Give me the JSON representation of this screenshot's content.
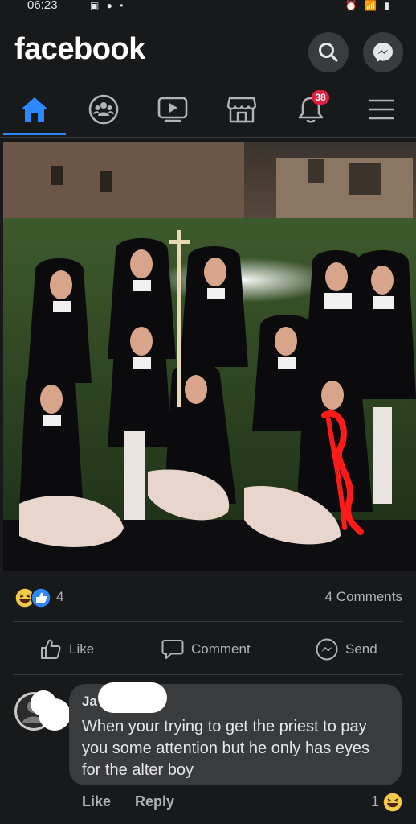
{
  "status_bar": {
    "time": "06:23",
    "left_icons": "▣ ● •",
    "right_icons": "⏰ 📶 ▮"
  },
  "header": {
    "brand": "facebook",
    "search_icon": "search-icon",
    "messenger_icon": "messenger-icon"
  },
  "tabs": [
    {
      "name": "home",
      "icon": "home-icon",
      "active": true
    },
    {
      "name": "groups",
      "icon": "groups-icon",
      "active": false
    },
    {
      "name": "watch",
      "icon": "watch-icon",
      "active": false
    },
    {
      "name": "marketplace",
      "icon": "marketplace-icon",
      "active": false
    },
    {
      "name": "notifications",
      "icon": "bell-icon",
      "badge": "38",
      "active": false
    },
    {
      "name": "menu",
      "icon": "menu-icon",
      "active": false
    }
  ],
  "post": {
    "reaction_count": "4",
    "comments_count": "4 Comments",
    "actions": {
      "like": "Like",
      "comment": "Comment",
      "send": "Send"
    }
  },
  "comment": {
    "author": "Ja                s",
    "text": "When your trying to get the priest to pay you some attention but he only has eyes for the alter boy",
    "like": "Like",
    "reply": "Reply",
    "reaction_count": "1"
  },
  "colors": {
    "background": "#18191a",
    "accent": "#2d88ff",
    "badge": "#e41e3f",
    "bubble": "#3a3b3c"
  }
}
